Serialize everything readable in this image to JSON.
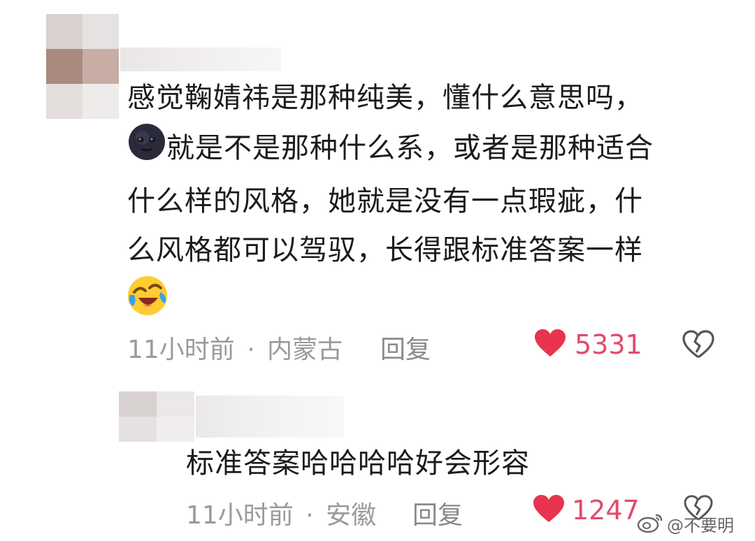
{
  "comments": [
    {
      "text_lines": [
        "感觉鞠婧祎是那种纯美，懂什么意思吗，",
        "就是不是那种什么系，或者是那种适合",
        "什么样的风格，她就是没有一点瑕疵，什",
        "么风格都可以驾驭，长得跟标准答案一样"
      ],
      "time": "11小时前",
      "location": "内蒙古",
      "separator": "·",
      "reply_label": "回复",
      "likes": "5331",
      "emojis": [
        "dark-moon-face-icon",
        "rofl-crying-laughing-icon"
      ]
    },
    {
      "text": "标准答案哈哈哈哈好会形容",
      "time": "11小时前",
      "location": "安徽",
      "separator": "·",
      "reply_label": "回复",
      "likes": "1247"
    }
  ],
  "watermark": "@不要明",
  "colors": {
    "like_red": "#e8344e",
    "likes_text": "#e24a6a",
    "meta_gray": "#9a9a9a"
  }
}
